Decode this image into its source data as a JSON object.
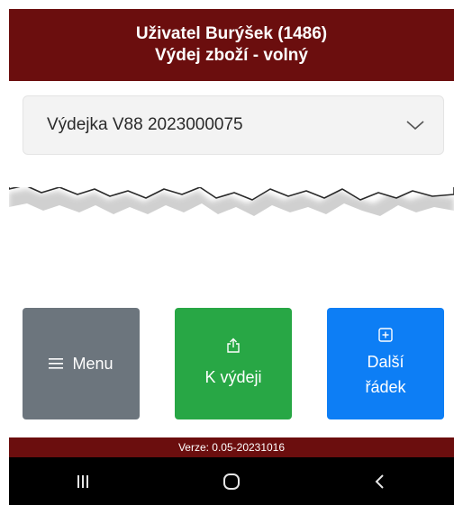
{
  "header": {
    "user_line": "Uživatel Burýšek (1486)",
    "screen_title": "Výdej zboží - volný"
  },
  "document_select": {
    "value": "Výdejka V88 2023000075"
  },
  "buttons": {
    "menu_label": "Menu",
    "issue_label": "K výdeji",
    "next_line1": "Další",
    "next_line2": "řádek"
  },
  "footer": {
    "version": "Verze: 0.05-20231016"
  },
  "icons": {
    "menu": "hamburger-icon",
    "issue": "share-upload-icon",
    "next": "plus-square-icon",
    "select": "chevron-down-icon",
    "nav_recent": "recent-apps-icon",
    "nav_home": "home-icon",
    "nav_back": "back-icon"
  },
  "colors": {
    "header": "#6b0e0e",
    "menu_button": "#6c757d",
    "issue_button": "#28a745",
    "next_button": "#0d7ef5",
    "nav_bar": "#000000"
  }
}
